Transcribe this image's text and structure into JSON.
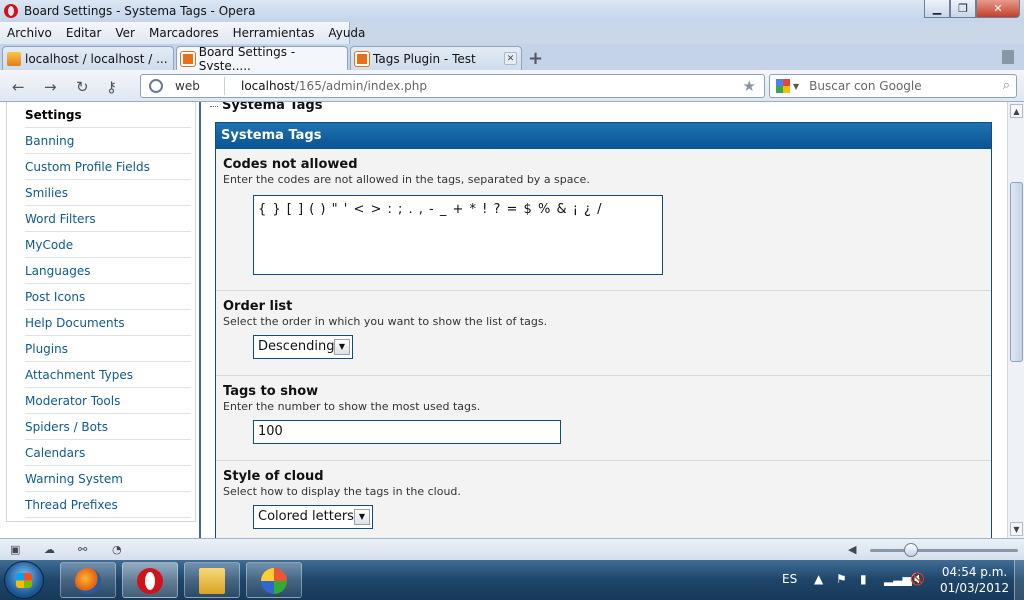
{
  "window": {
    "title": "Board Settings - Systema Tags - Opera"
  },
  "menu": [
    "Archivo",
    "Editar",
    "Ver",
    "Marcadores",
    "Herramientas",
    "Ayuda"
  ],
  "tabs": [
    {
      "label": "localhost / localhost / ..."
    },
    {
      "label": "Board Settings - Syste....."
    },
    {
      "label": "Tags Plugin - Test"
    }
  ],
  "address": {
    "web_label": "web",
    "host": "localhost",
    "path": "/165/admin/index.php",
    "search_placeholder": "Buscar con Google"
  },
  "sidebar": {
    "items": [
      "Settings",
      "Banning",
      "Custom Profile Fields",
      "Smilies",
      "Word Filters",
      "MyCode",
      "Languages",
      "Post Icons",
      "Help Documents",
      "Plugins",
      "Attachment Types",
      "Moderator Tools",
      "Spiders / Bots",
      "Calendars",
      "Warning System",
      "Thread Prefixes"
    ]
  },
  "page": {
    "section_title": "Systema Tags",
    "panel_title": "Systema Tags",
    "codes": {
      "label": "Codes not allowed",
      "desc": "Enter the codes are not allowed in the tags, separated by a space.",
      "value": "{ } [ ] ( ) \" ' < > : ; . , - _ + * ! ? = $ % & ¡ ¿ /"
    },
    "order": {
      "label": "Order list",
      "desc": "Select the order in which you want to show the list of tags.",
      "value": "Descending"
    },
    "tags_show": {
      "label": "Tags to show",
      "desc": "Enter the number to show the most used tags.",
      "value": "100"
    },
    "style": {
      "label": "Style of cloud",
      "desc": "Select how to display the tags in the cloud.",
      "value": "Colored letters"
    }
  },
  "taskbar": {
    "lang": "ES",
    "time": "04:54 p.m.",
    "date": "01/03/2012"
  }
}
